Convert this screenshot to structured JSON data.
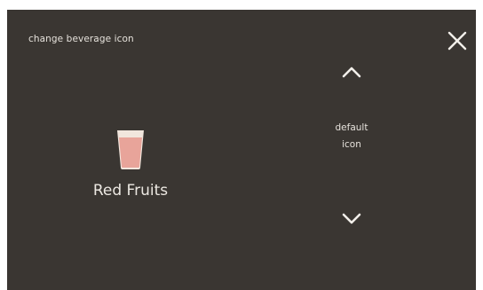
{
  "header": {
    "title": "change beverage icon",
    "close_icon": "close-icon"
  },
  "preview": {
    "icon": "cup-icon",
    "name": "Red Fruits",
    "cup_fill_color": "#e8a49a",
    "cup_glass_color": "#f1e6dd"
  },
  "icon_selector": {
    "up_icon": "chevron-up-icon",
    "down_icon": "chevron-down-icon",
    "label_line1": "default",
    "label_line2": "icon"
  },
  "colors": {
    "background": "#3a3632",
    "text": "#e8e4df"
  }
}
